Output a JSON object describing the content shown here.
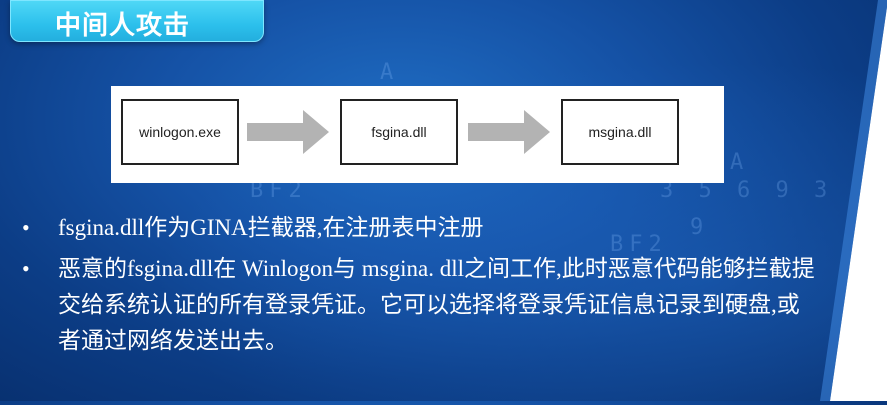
{
  "title": "中间人攻击",
  "diagram": {
    "nodes": [
      "winlogon.exe",
      "fsgina.dll",
      "msgina.dll"
    ]
  },
  "bullets": [
    "fsgina.dll作为GINA拦截器,在注册表中注册",
    "恶意的fsgina.dll在 Winlogon与 msgina. dll之间工作,此时恶意代码能够拦截提交给系统认证的所有登录凭证。它可以选择将登录凭证信息记录到硬盘,或者通过网络发送出去。"
  ],
  "bullet_marker": "•"
}
